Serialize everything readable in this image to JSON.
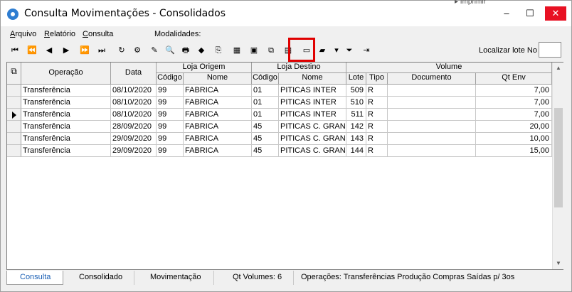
{
  "window": {
    "title": "Consulta Movimentações - Consolidados",
    "controls": {
      "minimize": "–",
      "maximize": "☐",
      "close": "✕"
    },
    "behind_text": "▸ Imprimir"
  },
  "menu": {
    "items": [
      "Arquivo",
      "Relatório",
      "Consulta"
    ],
    "modalidades_label": "Modalidades:"
  },
  "toolbar": {
    "buttons": [
      {
        "icon": "first-record-icon",
        "glyph": "⏮"
      },
      {
        "icon": "previous-page-icon",
        "glyph": "⏪"
      },
      {
        "icon": "previous-record-icon",
        "glyph": "◀"
      },
      {
        "icon": "next-record-icon",
        "glyph": "▶"
      },
      {
        "icon": "next-page-icon",
        "glyph": "⏩"
      },
      {
        "icon": "last-record-icon",
        "glyph": "⏭"
      },
      {
        "icon": "refresh-icon",
        "glyph": "↻"
      },
      {
        "icon": "settings-icon",
        "glyph": "⚙"
      },
      {
        "icon": "wand-icon",
        "glyph": "✎"
      },
      {
        "icon": "preview-icon",
        "glyph": "🔍"
      },
      {
        "icon": "print-icon",
        "glyph": "🖶"
      },
      {
        "icon": "bookmark-icon",
        "glyph": "◆"
      },
      {
        "icon": "goto-icon",
        "glyph": "⎘"
      },
      {
        "icon": "filter-icon",
        "glyph": "▦"
      },
      {
        "icon": "filter-box-icon",
        "glyph": "▣"
      },
      {
        "icon": "export-icon",
        "glyph": "⧉"
      },
      {
        "icon": "spreadsheet-icon",
        "glyph": "▤"
      },
      {
        "icon": "window-icon",
        "glyph": "▭"
      },
      {
        "icon": "folder-icon",
        "glyph": "▰"
      },
      {
        "icon": "dropdown-icon",
        "glyph": "▾"
      },
      {
        "icon": "funnel-icon",
        "glyph": "⏷"
      },
      {
        "icon": "exit-icon",
        "glyph": "⇥"
      }
    ],
    "locate_label": "Localizar lote No",
    "locate_value": ""
  },
  "colors": {
    "highlight": "#e00000",
    "close_button": "#e81123",
    "active_tab_text": "#1a5fb4"
  },
  "grid": {
    "headers": {
      "operacao": "Operação",
      "data": "Data",
      "loja_origem": "Loja Origem",
      "loja_destino": "Loja Destino",
      "volume": "Volume",
      "codigo": "Código",
      "nome": "Nome",
      "lote": "Lote",
      "tipo": "Tipo",
      "documento": "Documento",
      "qt_env": "Qt Env"
    },
    "rows": [
      {
        "operacao": "Transferência",
        "data": "08/10/2020",
        "orig_codigo": "99",
        "orig_nome": "FABRICA",
        "dest_codigo": "01",
        "dest_nome": "PITICAS INTER",
        "lote": "509",
        "tipo": "R",
        "documento": "",
        "qt_env": "7,00",
        "current": false
      },
      {
        "operacao": "Transferência",
        "data": "08/10/2020",
        "orig_codigo": "99",
        "orig_nome": "FABRICA",
        "dest_codigo": "01",
        "dest_nome": "PITICAS INTER",
        "lote": "510",
        "tipo": "R",
        "documento": "",
        "qt_env": "7,00",
        "current": false
      },
      {
        "operacao": "Transferência",
        "data": "08/10/2020",
        "orig_codigo": "99",
        "orig_nome": "FABRICA",
        "dest_codigo": "01",
        "dest_nome": "PITICAS INTER",
        "lote": "511",
        "tipo": "R",
        "documento": "",
        "qt_env": "7,00",
        "current": true
      },
      {
        "operacao": "Transferência",
        "data": "28/09/2020",
        "orig_codigo": "99",
        "orig_nome": "FABRICA",
        "dest_codigo": "45",
        "dest_nome": "PITICAS C. GRAND",
        "lote": "142",
        "tipo": "R",
        "documento": "",
        "qt_env": "20,00",
        "current": false
      },
      {
        "operacao": "Transferência",
        "data": "29/09/2020",
        "orig_codigo": "99",
        "orig_nome": "FABRICA",
        "dest_codigo": "45",
        "dest_nome": "PITICAS C. GRAND",
        "lote": "143",
        "tipo": "R",
        "documento": "",
        "qt_env": "10,00",
        "current": false
      },
      {
        "operacao": "Transferência",
        "data": "29/09/2020",
        "orig_codigo": "99",
        "orig_nome": "FABRICA",
        "dest_codigo": "45",
        "dest_nome": "PITICAS C. GRAND",
        "lote": "144",
        "tipo": "R",
        "documento": "",
        "qt_env": "15,00",
        "current": false
      }
    ]
  },
  "scrollbar": {
    "up": "▲",
    "down": "▼"
  },
  "status": {
    "tabs": [
      "Consulta",
      "Consolidado",
      "Movimentação"
    ],
    "qt_volumes": "Qt Volumes: 6",
    "operacoes": "Operações:  Transferências Produção Compras Saídas p/ 3os"
  }
}
